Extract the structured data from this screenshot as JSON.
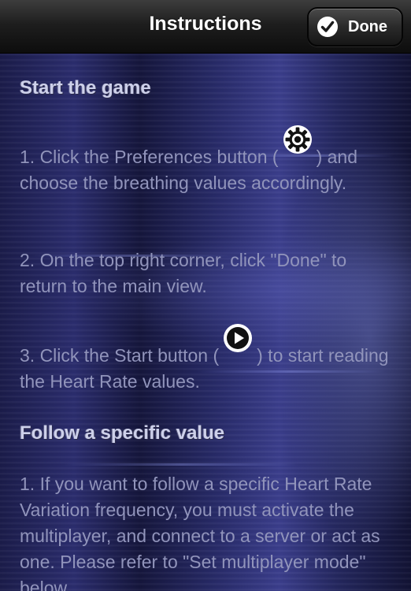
{
  "navbar": {
    "title": "Instructions",
    "done_label": "Done"
  },
  "sections": {
    "start": {
      "heading": "Start the game",
      "step1_before": "1. Click the Preferences button (",
      "step1_after": ") and choose the breathing values accordingly.",
      "step2": "2. On the top right corner, click \"Done\" to return to the main view.",
      "step3_before": "3. Click the Start button (",
      "step3_after": ") to start reading the Heart Rate values."
    },
    "follow": {
      "heading": "Follow a specific value",
      "step1": "1. If you want to follow a specific Heart Rate Variation frequency, you must activate the multiplayer, and connect to a server or act as one. Please refer to \"Set multiplayer mode\" below."
    }
  },
  "icons": {
    "done": "checkmark-icon",
    "preferences": "gear-icon",
    "start": "play-icon"
  },
  "colors": {
    "navbar": "#1e1e1e",
    "heading_text": "#cdd0ea",
    "body_text": "#9194bb",
    "background": "#1b1c4a"
  }
}
